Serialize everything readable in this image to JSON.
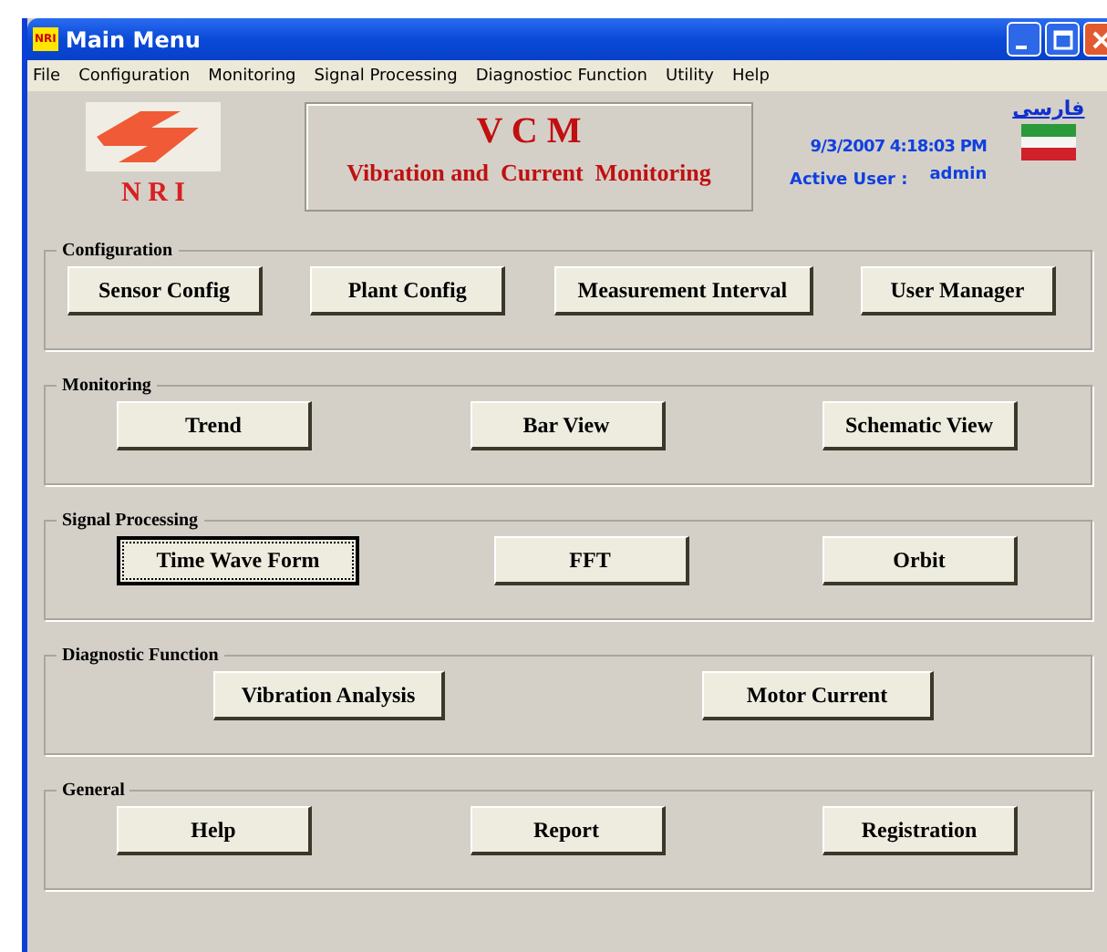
{
  "window": {
    "title": "Main Menu",
    "app_icon": "NRI"
  },
  "menu": [
    "File",
    "Configuration",
    "Monitoring",
    "Signal Processing",
    "Diagnostioc Function",
    "Utility",
    "Help"
  ],
  "header": {
    "logo_text": "N R I",
    "banner_title": "V C M",
    "banner_subtitle": "Vibration and  Current  Monitoring",
    "language_link": "فارسی",
    "datetime": "9/3/2007 4:18:03 PM",
    "user_label": "Active User :",
    "user_value": "admin"
  },
  "groups": [
    {
      "title": "Configuration",
      "buttons": [
        {
          "label": "Sensor Config",
          "focused": false
        },
        {
          "label": "Plant Config",
          "focused": false
        },
        {
          "label": "Measurement Interval",
          "focused": false
        },
        {
          "label": "User Manager",
          "focused": false
        }
      ]
    },
    {
      "title": "Monitoring",
      "buttons": [
        {
          "label": "Trend",
          "focused": false
        },
        {
          "label": "Bar View",
          "focused": false
        },
        {
          "label": "Schematic View",
          "focused": false
        }
      ]
    },
    {
      "title": "Signal Processing",
      "buttons": [
        {
          "label": "Time Wave Form",
          "focused": true
        },
        {
          "label": "FFT",
          "focused": false
        },
        {
          "label": "Orbit",
          "focused": false
        }
      ]
    },
    {
      "title": "Diagnostic Function",
      "buttons": [
        {
          "label": "Vibration Analysis",
          "focused": false
        },
        {
          "label": "Motor Current",
          "focused": false
        }
      ]
    },
    {
      "title": "General",
      "buttons": [
        {
          "label": "Help",
          "focused": false
        },
        {
          "label": "Report",
          "focused": false
        },
        {
          "label": "Registration",
          "focused": false
        }
      ]
    }
  ]
}
